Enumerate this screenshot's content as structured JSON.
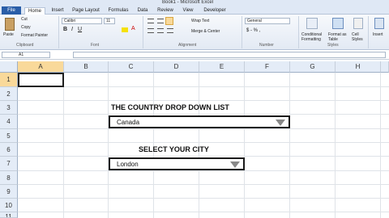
{
  "window": {
    "title": "Book1 - Microsoft Excel"
  },
  "tabs": [
    "File",
    "Home",
    "Insert",
    "Page Layout",
    "Formulas",
    "Data",
    "Review",
    "View",
    "Developer"
  ],
  "ribbon": {
    "paste": "Paste",
    "cut": "Cut",
    "copy": "Copy",
    "format_painter": "Format Painter",
    "clipboard": "Clipboard",
    "font_name": "Calibri",
    "font_size": "11",
    "font": "Font",
    "alignment": "Alignment",
    "wrap_text": "Wrap Text",
    "merge_center": "Merge & Center",
    "number_format": "General",
    "number": "Number",
    "conditional_formatting": "Conditional Formatting",
    "format_as_table": "Format as Table",
    "cell_styles": "Cell Styles",
    "styles": "Styles",
    "insert": "Insert"
  },
  "name_box": "A1",
  "columns": [
    "A",
    "B",
    "C",
    "D",
    "E",
    "F",
    "G",
    "H"
  ],
  "rows": [
    "1",
    "2",
    "3",
    "4",
    "5",
    "6",
    "7",
    "8",
    "9",
    "10",
    "11"
  ],
  "sheet": {
    "country_heading": "THE  COUNTRY DROP DOWN LIST",
    "country_value": "Canada",
    "city_heading": "SELECT YOUR CITY",
    "city_value": "London"
  }
}
